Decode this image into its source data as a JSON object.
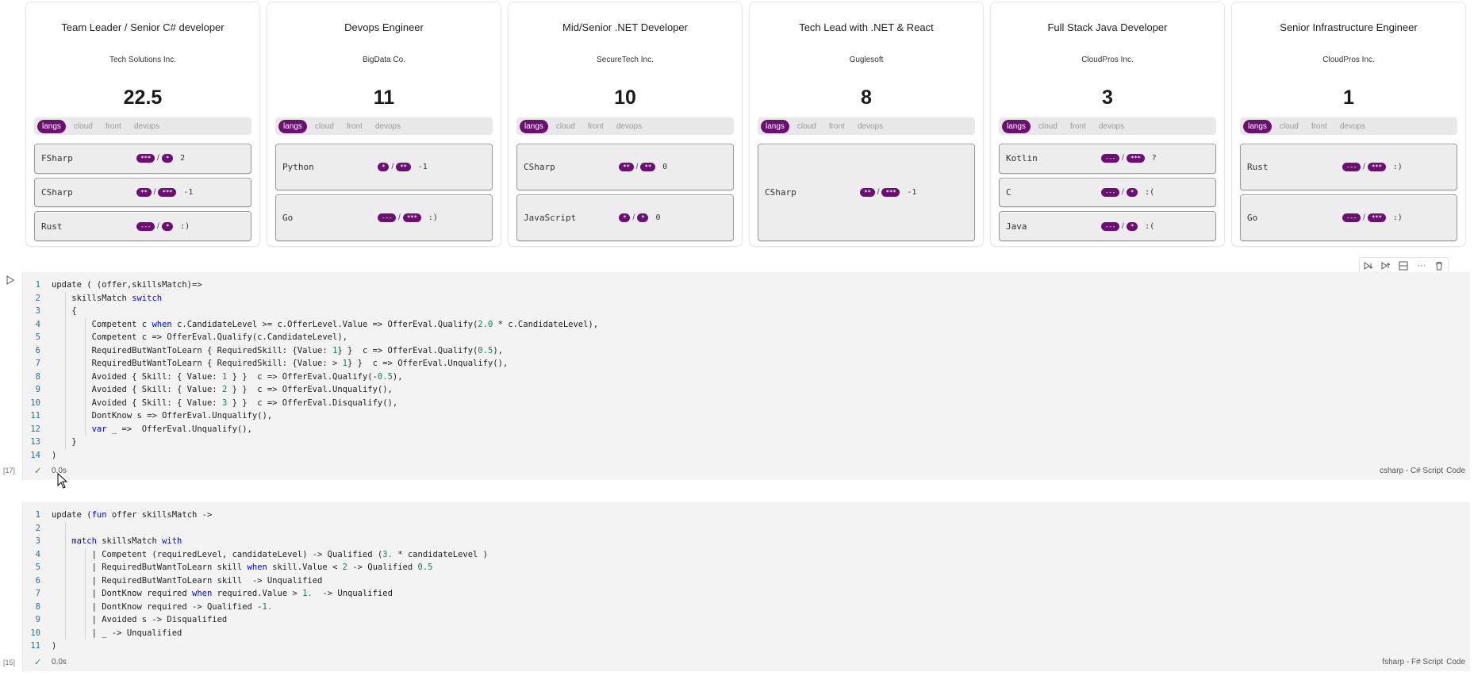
{
  "cards": [
    {
      "title": "Team Leader / Senior C# developer",
      "company": "Tech Solutions Inc.",
      "score": "22.5",
      "tabs": [
        "langs",
        "cloud",
        "front",
        "devops"
      ],
      "skills": [
        {
          "name": "FSharp",
          "required": "***",
          "candidate": "*",
          "result": "2"
        },
        {
          "name": "CSharp",
          "required": "**",
          "candidate": "***",
          "result": "-1"
        },
        {
          "name": "Rust",
          "required": "---",
          "candidate": "*",
          "result": ":)"
        }
      ]
    },
    {
      "title": "Devops Engineer",
      "company": "BigData Co.",
      "score": "11",
      "tabs": [
        "langs",
        "cloud",
        "front",
        "devops"
      ],
      "skills": [
        {
          "name": "Python",
          "required": "*",
          "candidate": "**",
          "result": "-1"
        },
        {
          "name": "Go",
          "required": "---",
          "candidate": "***",
          "result": ":)"
        }
      ]
    },
    {
      "title": "Mid/Senior .NET Developer",
      "company": "SecureTech Inc.",
      "score": "10",
      "tabs": [
        "langs",
        "cloud",
        "front",
        "devops"
      ],
      "skills": [
        {
          "name": "CSharp",
          "required": "**",
          "candidate": "**",
          "result": "0"
        },
        {
          "name": "JavaScript",
          "required": "*",
          "candidate": "*",
          "result": "0"
        }
      ]
    },
    {
      "title": "Tech Lead with .NET & React",
      "company": "Guglesoft",
      "score": "8",
      "tabs": [
        "langs",
        "cloud",
        "front",
        "devops"
      ],
      "skills": [
        {
          "name": "CSharp",
          "required": "**",
          "candidate": "***",
          "result": "-1"
        }
      ]
    },
    {
      "title": "Full Stack Java Developer",
      "company": "CloudPros Inc.",
      "score": "3",
      "tabs": [
        "langs",
        "cloud",
        "front",
        "devops"
      ],
      "skills": [
        {
          "name": "Kotlin",
          "required": "---",
          "candidate": "***",
          "result": "?"
        },
        {
          "name": "C",
          "required": "---",
          "candidate": "*",
          "result": ":("
        },
        {
          "name": "Java",
          "required": "---",
          "candidate": "*",
          "result": ":("
        }
      ]
    },
    {
      "title": "Senior Infrastructure Engineer",
      "company": "CloudPros Inc.",
      "score": "1",
      "tabs": [
        "langs",
        "cloud",
        "front",
        "devops"
      ],
      "skills": [
        {
          "name": "Rust",
          "required": "---",
          "candidate": "***",
          "result": ":)"
        },
        {
          "name": "Go",
          "required": "---",
          "candidate": "***",
          "result": ":)"
        }
      ]
    }
  ],
  "cell1": {
    "exec_count": "[17]",
    "duration": "0.0s",
    "language": "csharp - C# Script",
    "kind": "Code",
    "lines": [
      [
        [
          "t",
          "update ( (offer,skillsMatch)=>"
        ]
      ],
      [
        [
          "t",
          "    skillsMatch "
        ],
        [
          "k",
          "switch"
        ]
      ],
      [
        [
          "t",
          "    {"
        ]
      ],
      [
        [
          "t",
          "        Competent c "
        ],
        [
          "k",
          "when"
        ],
        [
          "t",
          " c.CandidateLevel >= c.OfferLevel.Value => OfferEval.Qualify("
        ],
        [
          "n",
          "2.0"
        ],
        [
          "t",
          " * c.CandidateLevel),"
        ]
      ],
      [
        [
          "t",
          "        Competent c => OfferEval.Qualify(c.CandidateLevel),"
        ]
      ],
      [
        [
          "t",
          "        RequiredButWantToLearn { RequiredSkill: {Value: "
        ],
        [
          "n",
          "1"
        ],
        [
          "t",
          "} }  c => OfferEval.Qualify("
        ],
        [
          "n",
          "0.5"
        ],
        [
          "t",
          "),"
        ]
      ],
      [
        [
          "t",
          "        RequiredButWantToLearn { RequiredSkill: {Value: > "
        ],
        [
          "n",
          "1"
        ],
        [
          "t",
          "} }  c => OfferEval.Unqualify(),"
        ]
      ],
      [
        [
          "t",
          "        Avoided { Skill: { Value: "
        ],
        [
          "n",
          "1"
        ],
        [
          "t",
          " } }  c => OfferEval.Qualify(-"
        ],
        [
          "n",
          "0.5"
        ],
        [
          "t",
          "),"
        ]
      ],
      [
        [
          "t",
          "        Avoided { Skill: { Value: "
        ],
        [
          "n",
          "2"
        ],
        [
          "t",
          " } }  c => OfferEval.Unqualify(),"
        ]
      ],
      [
        [
          "t",
          "        Avoided { Skill: { Value: "
        ],
        [
          "n",
          "3"
        ],
        [
          "t",
          " } }  c => OfferEval.Disqualify(),"
        ]
      ],
      [
        [
          "t",
          "        DontKnow s => OfferEval.Unqualify(),"
        ]
      ],
      [
        [
          "k",
          "        var"
        ],
        [
          "t",
          " _ =>  OfferEval.Unqualify(),"
        ]
      ],
      [
        [
          "t",
          "    }"
        ]
      ],
      [
        [
          "t",
          ")"
        ]
      ]
    ]
  },
  "cell2": {
    "exec_count": "[15]",
    "duration": "0.0s",
    "language": "fsharp - F# Script",
    "kind": "Code",
    "lines": [
      [
        [
          "t",
          "update ("
        ],
        [
          "k",
          "fun"
        ],
        [
          "t",
          " offer skillsMatch ->"
        ]
      ],
      [
        [
          "t",
          ""
        ]
      ],
      [
        [
          "k",
          "    match"
        ],
        [
          "t",
          " skillsMatch "
        ],
        [
          "k",
          "with"
        ]
      ],
      [
        [
          "t",
          "        | Competent (requiredLevel, candidateLevel) -> Qualified ("
        ],
        [
          "n",
          "3."
        ],
        [
          "t",
          " * candidateLevel )"
        ]
      ],
      [
        [
          "t",
          "        | RequiredButWantToLearn skill "
        ],
        [
          "k",
          "when"
        ],
        [
          "t",
          " skill.Value < "
        ],
        [
          "n",
          "2"
        ],
        [
          "t",
          " -> Qualified "
        ],
        [
          "n",
          "0.5"
        ]
      ],
      [
        [
          "t",
          "        | RequiredButWantToLearn skill  -> Unqualified"
        ]
      ],
      [
        [
          "t",
          "        | DontKnow required "
        ],
        [
          "k",
          "when"
        ],
        [
          "t",
          " required.Value > "
        ],
        [
          "n",
          "1."
        ],
        [
          "t",
          "  -> Unqualified"
        ]
      ],
      [
        [
          "t",
          "        | DontKnow required -> Qualified -"
        ],
        [
          "n",
          "1."
        ]
      ],
      [
        [
          "t",
          "        | Avoided s -> Disqualified"
        ]
      ],
      [
        [
          "t",
          "        | _ -> Unqualified"
        ]
      ],
      [
        [
          "t",
          ")"
        ]
      ]
    ]
  },
  "toolbar_icons": [
    "execute-above-icon",
    "execute-below-icon",
    "split-cell-icon",
    "more-icon",
    "delete-icon"
  ],
  "colors": {
    "accent": "#6b0f72",
    "keyword": "#0000ff",
    "number": "#098658",
    "line_number": "#237893"
  }
}
